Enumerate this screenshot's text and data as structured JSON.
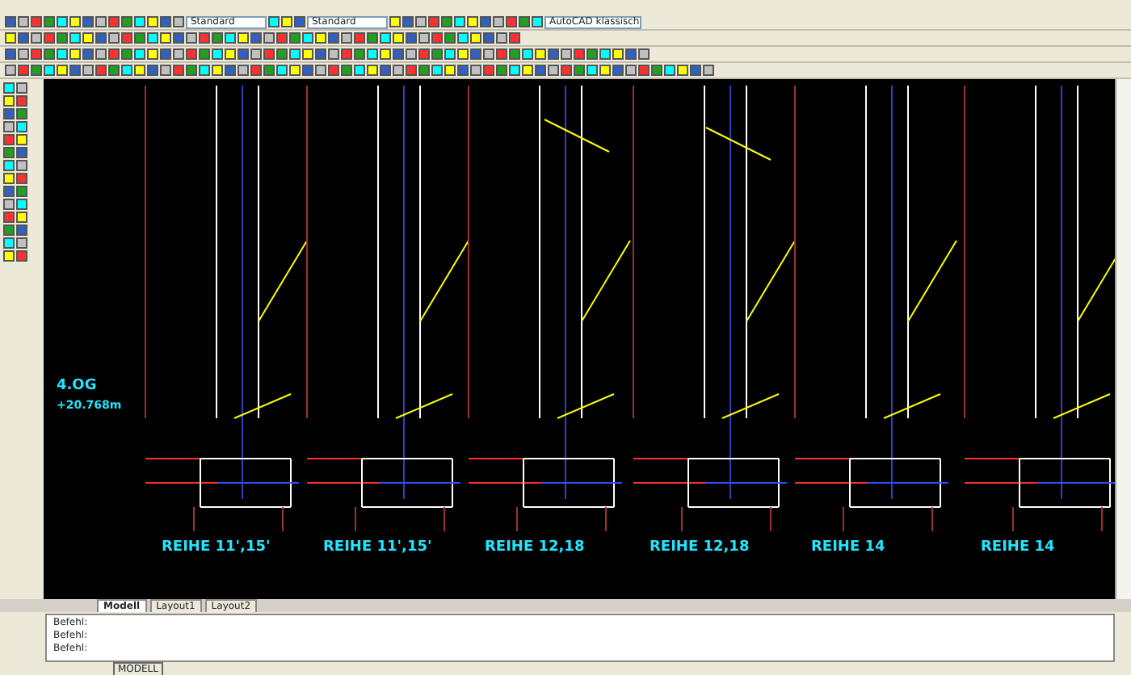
{
  "toolbars": {
    "style_combo": "Standard",
    "dim_combo": "Standard",
    "workspace_combo": "AutoCAD klassisch"
  },
  "drawing": {
    "level_label": "4.OG",
    "elevation": "+20.768m",
    "rows": [
      {
        "label": "REIHE 11',15'"
      },
      {
        "label": "REIHE 11',15'"
      },
      {
        "label": "REIHE 12,18"
      },
      {
        "label": "REIHE 12,18"
      },
      {
        "label": "REIHE 14"
      },
      {
        "label": "REIHE 14"
      }
    ]
  },
  "layout_tabs": [
    {
      "label": "Modell",
      "selected": true
    },
    {
      "label": "Layout1",
      "selected": false
    },
    {
      "label": "Layout2",
      "selected": false
    }
  ],
  "command_lines": [
    "Befehl:",
    "Befehl:",
    "Befehl:"
  ],
  "status_bar": {
    "mode_button": "MODELL"
  }
}
